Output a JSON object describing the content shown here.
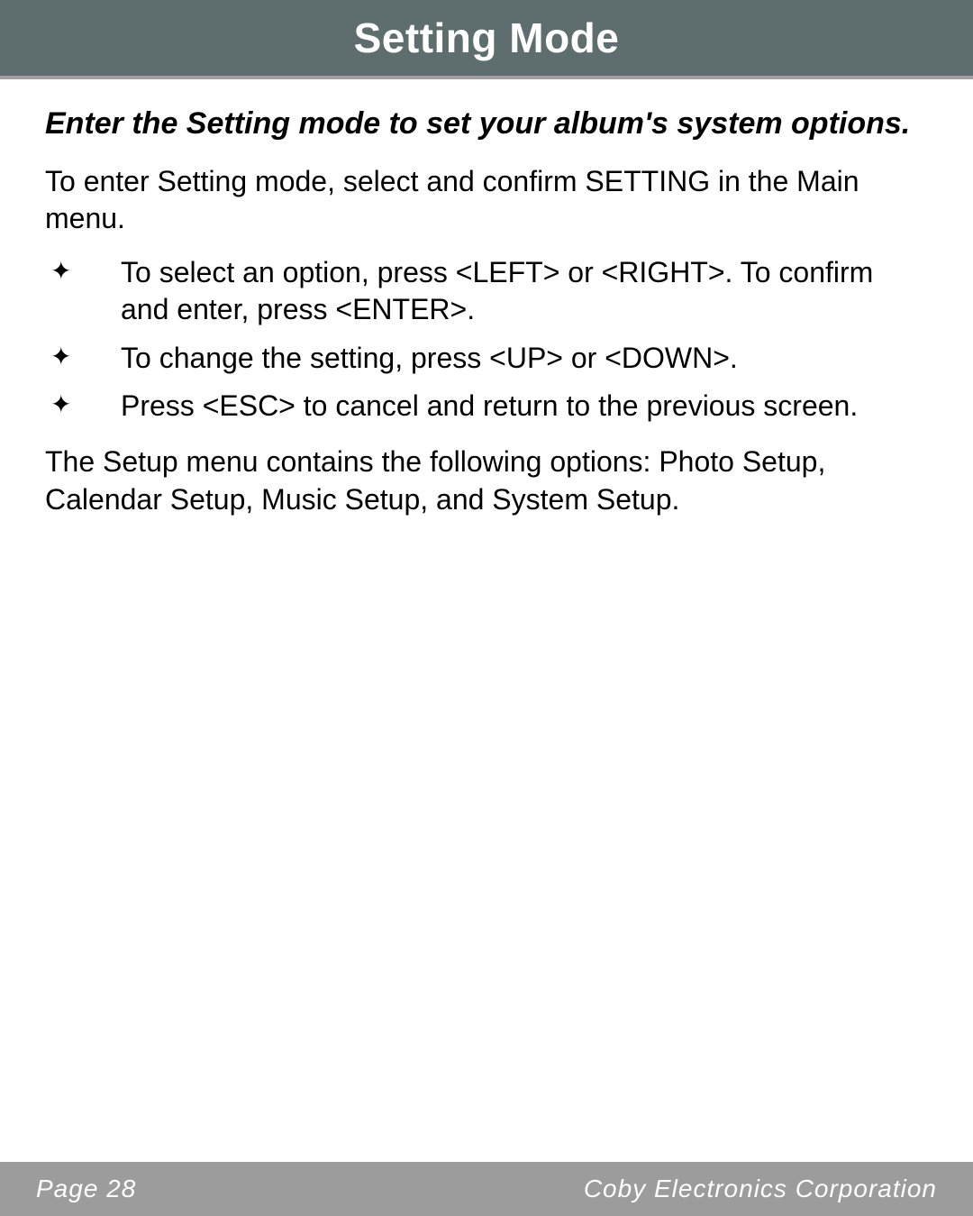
{
  "header": {
    "title": "Setting Mode"
  },
  "content": {
    "subtitle": "Enter the Setting mode to set your album's system options.",
    "intro": "To enter Setting mode, select and confirm SETTING in the Main menu.",
    "bullets": [
      "To select an option, press <LEFT> or <RIGHT>. To confirm and enter, press <ENTER>.",
      "To change the setting, press <UP> or <DOWN>.",
      "Press <ESC> to cancel and return to the previous screen."
    ],
    "outro": "The Setup menu contains the following options: Photo Setup, Calendar Setup, Music Setup, and System Setup."
  },
  "footer": {
    "page_label": "Page 28",
    "company": "Coby Electronics Corporation"
  }
}
